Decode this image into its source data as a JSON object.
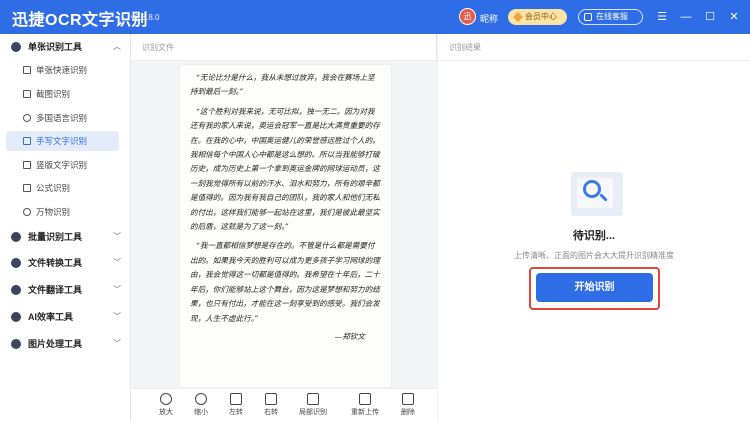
{
  "app": {
    "title": "迅捷OCR文字识别",
    "version": "v8.8.8.0"
  },
  "header": {
    "avatar_text": "迅",
    "nickname": "昵称",
    "vip_label": "会员中心",
    "service_label": "在线客服",
    "window_controls": [
      "menu-icon",
      "minimize-icon",
      "maximize-icon",
      "close-icon"
    ]
  },
  "sidebar": {
    "groups": [
      {
        "label": "单张识别工具",
        "expanded": true,
        "items": [
          {
            "label": "单张快速识别",
            "active": false
          },
          {
            "label": "截图识别",
            "active": false
          },
          {
            "label": "多国语言识别",
            "active": false
          },
          {
            "label": "手写文字识别",
            "active": true
          },
          {
            "label": "竖版文字识别",
            "active": false
          },
          {
            "label": "公式识别",
            "active": false
          },
          {
            "label": "万物识别",
            "active": false
          }
        ]
      },
      {
        "label": "批量识别工具",
        "expanded": false
      },
      {
        "label": "文件转换工具",
        "expanded": false
      },
      {
        "label": "文件翻译工具",
        "expanded": false
      },
      {
        "label": "AI效率工具",
        "expanded": false
      },
      {
        "label": "图片处理工具",
        "expanded": false
      }
    ]
  },
  "file_panel": {
    "title": "识别文件",
    "document": {
      "paragraphs": [
        "“无论比分是什么，我从未想过放弃，我会在赛场上坚持到最后一刻。”",
        "“这个胜利对我来说，无可比拟，独一无二。因为对我还有我的家人来说，奥运会冠军一直是比大满贯重要的存在。在我的心中，中国奥运健儿的荣誉感远胜过个人的。我相信每个中国人心中都是这么想的。所以当我能够打破历史，成为历史上第一个拿到奥运金牌的网球运动员，这一刻我觉得所有以前的汗水、泪水和努力，所有的艰辛都是值得的。因为我有我自己的团队，我的家人和他们无私的付出，这样我们能够一起站在这里，我们是彼此最坚实的后盾，这就是为了这一刻。”",
        "“我一直都相信梦想是存在的。不管是什么都是需要付出的。如果我今天的胜利可以成为更多孩子学习网球的理由，我会觉得这一切都是值得的。我希望在十年后，二十年后，你们能够站上这个舞台，因为这是梦想和努力的结果，也只有付出，才能在这一刻享受到的感受。我们会发现，人生不虚此行。”"
      ],
      "signature": "—郑钦文"
    },
    "toolbar": [
      {
        "label": "放大",
        "icon": "zoom-in-icon"
      },
      {
        "label": "缩小",
        "icon": "zoom-out-icon"
      },
      {
        "label": "左转",
        "icon": "rotate-left-icon"
      },
      {
        "label": "右转",
        "icon": "rotate-right-icon"
      },
      {
        "label": "局部识别",
        "icon": "crop-icon"
      },
      {
        "label": "重新上传",
        "icon": "upload-icon"
      },
      {
        "label": "删除",
        "icon": "trash-icon"
      }
    ]
  },
  "result_panel": {
    "title": "识别结果",
    "pending_text": "待识别...",
    "tip": "上传清晰、正面的图片会大大提升识别精准度",
    "start_button": "开始识别"
  },
  "colors": {
    "brand": "#2f6de6",
    "highlight_border": "#e0453a",
    "active_item_bg": "#e4ecfb"
  }
}
